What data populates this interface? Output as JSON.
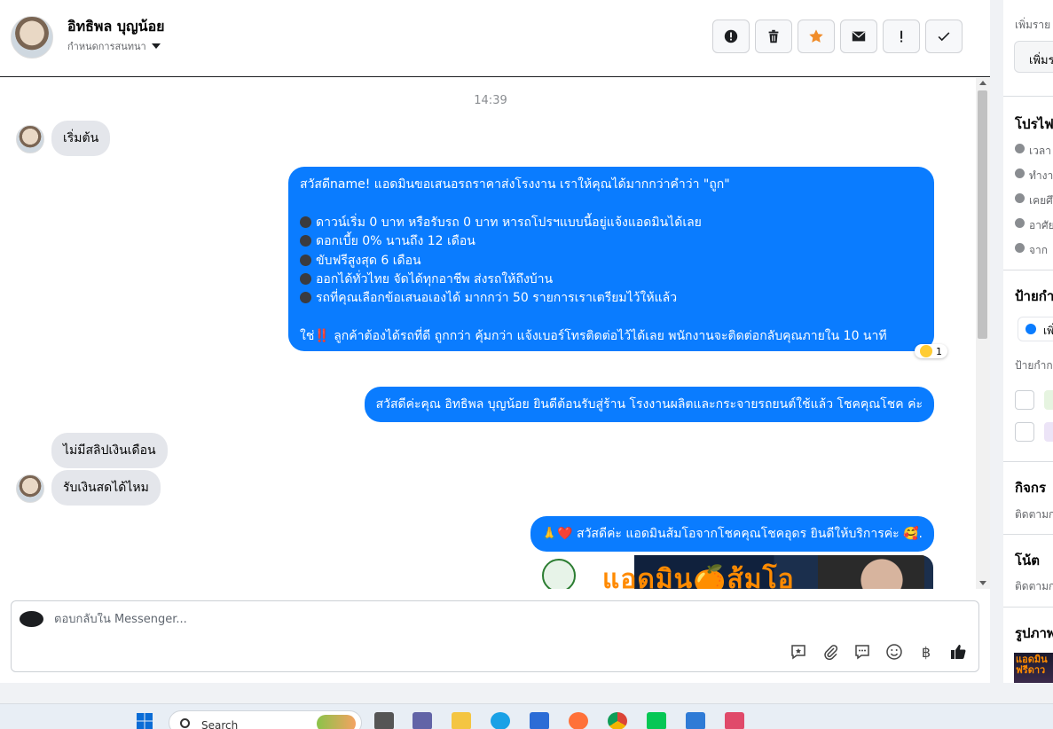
{
  "header": {
    "contact_name": "อิทธิพล บุญน้อย",
    "subtitle": "กำหนดการสนทนา",
    "actions": [
      {
        "name": "spam-button",
        "icon": "alert-circle-icon"
      },
      {
        "name": "delete-button",
        "icon": "trash-icon"
      },
      {
        "name": "star-button",
        "icon": "star-icon"
      },
      {
        "name": "mark-unread-button",
        "icon": "envelope-icon"
      },
      {
        "name": "follow-up-button",
        "icon": "exclamation-icon"
      },
      {
        "name": "done-button",
        "icon": "check-icon"
      }
    ]
  },
  "conversation": {
    "timestamp": "14:39",
    "incoming_1": "เริ่มต้น",
    "outgoing_promo": {
      "line1": "สวัสดีname! แอดมินขอเสนอรถราคาส่งโรงงาน เราให้คุณได้มากกว่าคำว่า \"ถูก\"",
      "bullets": [
        "ดาวน์เริ่ม 0 บาท หรือรับรถ 0 บาท หารถโปรฯแบบนี้อยู่แจ้งแอดมินได้เลย",
        "ดอกเบี้ย 0% นานถึง 12 เดือน",
        "ขับฟรีสูงสุด 6 เดือน",
        "ออกได้ทั่วไทย จัดได้ทุกอาชีพ ส่งรถให้ถึงบ้าน",
        "รถที่คุณเลือกข้อเสนอเองได้ มากกว่า 50 รายการเราเตรียมไว้ให้แล้ว"
      ],
      "closing_prefix": "ใช่",
      "closing_mark": "‼️",
      "closing_suffix": " ลูกค้าต้องได้รถที่ดี ถูกกว่า คุ้มกว่า แจ้งเบอร์โทรติดต่อไว้ได้เลย พนักงานจะติดต่อกลับคุณภายใน 10 นาที",
      "reaction_count": "1"
    },
    "outgoing_welcome": "สวัสดีค่ะคุณ อิทธิพล บุญน้อย ยินดีต้อนรับสู่ร้าน โรงงานผลิตและกระจายรถยนต์ใช้แล้ว โชคคุณโชค ค่ะ",
    "incoming_2": "ไม่มีสลิปเงินเดือน",
    "incoming_3": "รับเงินสดได้ไหม",
    "outgoing_admin": {
      "prefix": "🙏",
      "heart": "❤️",
      "text": " สวัสดีค่ะ แอดมินส้มโอจากโชคคุณโชคอุดร ยินดีให้บริการค่ะ ",
      "suffix": "🥰."
    },
    "promo_image_text": "แอดมิน🍊ส้มโอ"
  },
  "composer": {
    "placeholder": "ตอบกลับใน Messenger...",
    "tools": [
      "saved-reply-icon",
      "attachment-icon",
      "chat-bubble-icon",
      "emoji-icon",
      "baht-icon",
      "thumbs-up-icon"
    ],
    "baht_symbol": "฿"
  },
  "right_panel": {
    "add_label": "เพิ่มราย",
    "add_button": "เพิ่มร",
    "profile_heading": "โปรไฟ",
    "profile_rows": [
      "เวลา",
      "ทำงา",
      "เคยศึ",
      "อาศัย",
      "จาก"
    ],
    "labels_heading": "ป้ายกำ",
    "labels_add": "เพิ่",
    "labels_sub": "ป้ายกำก",
    "activities_heading": "กิจกร",
    "activities_sub": "ติดตามก",
    "notes_heading": "โน้ต",
    "notes_sub": "ติดตามก",
    "photos_heading": "รูปภาพ",
    "photo_thumb_text": "แอดมิน ฟรีดาว"
  },
  "taskbar": {
    "search_label": "Search",
    "apps": [
      "windows-start-icon",
      "task-view-icon",
      "teams-icon",
      "file-explorer-icon",
      "edge-icon",
      "store-icon",
      "firefox-icon",
      "chrome-icon",
      "line-icon",
      "notepad-icon",
      "snipping-tool-icon"
    ]
  },
  "colors": {
    "outgoing_bubble": "#0a7cff",
    "incoming_bubble": "#e4e6eb",
    "star_accent": "#f08c2a"
  }
}
